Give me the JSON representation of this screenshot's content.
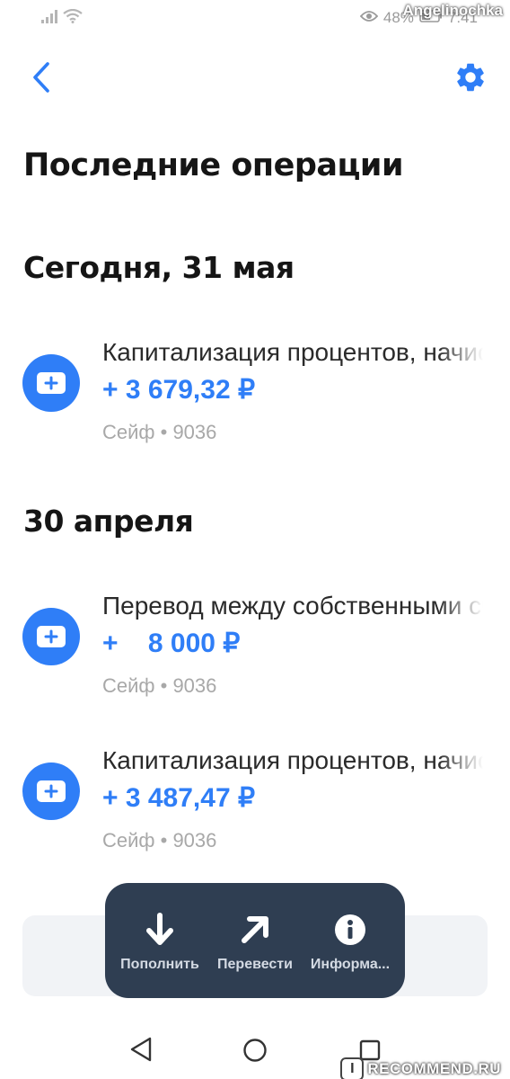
{
  "status_bar": {
    "battery": "48%",
    "time": "7:41",
    "watermark_user": "Angelinochka"
  },
  "header": {
    "back_icon": "chevron-left-icon",
    "settings_icon": "gear-icon",
    "title": "Последние операции"
  },
  "colors": {
    "accent": "#2f7ef7",
    "action_bar": "#2f3e52"
  },
  "groups": [
    {
      "date": "Сегодня, 31 мая",
      "transactions": [
        {
          "description": "Капитализация процентов, начисленных",
          "amount": "+ 3 679,32 ₽",
          "account": "Сейф • 9036"
        }
      ]
    },
    {
      "date": "30 апреля",
      "transactions": [
        {
          "description": "Перевод между собственными счетами",
          "amount": "+    8 000 ₽",
          "account": "Сейф • 9036"
        },
        {
          "description": "Капитализация процентов, начисленных",
          "amount": "+ 3 487,47 ₽",
          "account": "Сейф • 9036"
        }
      ]
    }
  ],
  "actions": [
    {
      "label": "Пополнить",
      "icon": "arrow-down-icon"
    },
    {
      "label": "Перевести",
      "icon": "arrow-up-right-icon"
    },
    {
      "label": "Информа...",
      "icon": "info-icon"
    }
  ],
  "watermark_site": "RECOMMEND.RU"
}
